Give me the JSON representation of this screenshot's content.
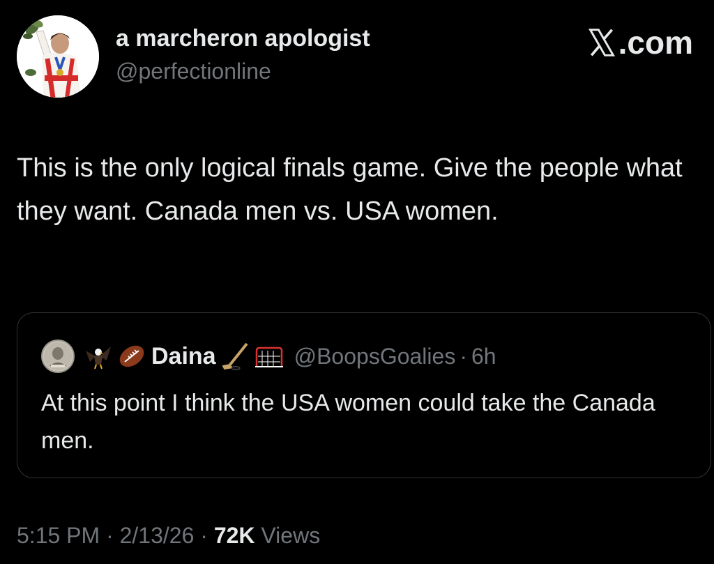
{
  "author": {
    "name": "a marcheron apologist",
    "handle": "@perfectionline"
  },
  "brand": {
    "suffix": ".com",
    "icon": "x-logo-icon"
  },
  "tweet": {
    "text": "This is the only logical finals game. Give the people what they want. Canada men vs. USA women."
  },
  "quote": {
    "name": "Daina",
    "handle": "@BoopsGoalies",
    "separator": "·",
    "time": "6h",
    "text": "At this point I think the USA women could take the Canada men.",
    "name_prefix_icons": [
      "eagle-emoji-icon",
      "football-emoji-icon"
    ],
    "name_suffix_icons": [
      "hockey-stick-emoji-icon",
      "goal-net-emoji-icon"
    ]
  },
  "meta": {
    "time": "5:15 PM",
    "sep1": "·",
    "date": "2/13/26",
    "sep2": "·",
    "views_count": "72K",
    "views_label": "Views"
  },
  "colors": {
    "background": "#000000",
    "primary_text": "#e7e9ea",
    "secondary_text": "#71767b",
    "border": "#2f3336"
  }
}
